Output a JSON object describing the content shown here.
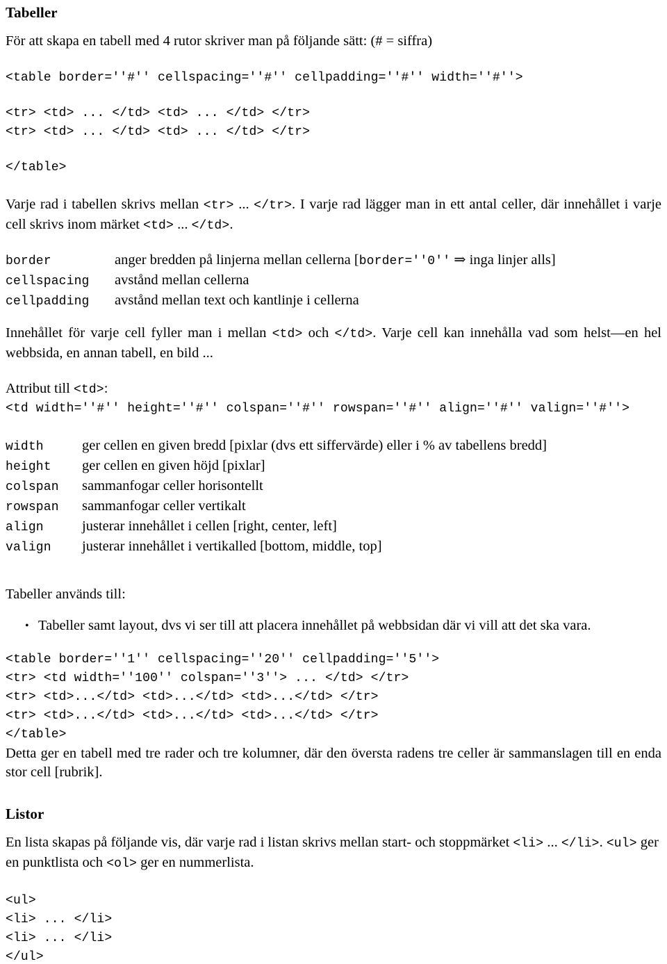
{
  "document": {
    "language": "sv",
    "sections": [
      {
        "id": "tabeller",
        "heading": "Tabeller"
      },
      {
        "id": "listor",
        "heading": "Listor"
      }
    ]
  },
  "tabeller": {
    "heading": "Tabeller",
    "intro": "För att skapa en tabell med 4 rutor skriver man på följande sätt: (# = siffra)",
    "code_block_1": "<table border=''#'' cellspacing=''#'' cellpadding=''#'' width=''#''>",
    "code_block_2_line1": "<tr> <td> ... </td> <td> ... </td> </tr>",
    "code_block_2_line2": "<tr> <td> ... </td> <td> ... </td> </tr>",
    "code_block_3": "</table>",
    "paragraph_rows": {
      "part1": "Varje rad i tabellen skrivs mellan ",
      "code1": "<tr>",
      "part2": " ... ",
      "code2": "</tr>",
      "part3": ". I varje rad lägger man in ett antal celler, där innehållet i varje cell skrivs inom märket ",
      "code3": "<td>",
      "part4": " ... ",
      "code4": "</td>",
      "part5": "."
    },
    "table_attrs": {
      "rows": [
        {
          "key": "border",
          "desc_pre": "anger bredden på linjerna mellan cellerna [",
          "desc_code": "border=''0''",
          "desc_mid": " ⇒ ",
          "desc_post": "inga linjer alls]"
        },
        {
          "key": "cellspacing",
          "desc_pre": "avstånd mellan cellerna",
          "desc_code": "",
          "desc_mid": "",
          "desc_post": ""
        },
        {
          "key": "cellpadding",
          "desc_pre": "avstånd mellan text och kantlinje i cellerna",
          "desc_code": "",
          "desc_mid": "",
          "desc_post": ""
        }
      ]
    },
    "paragraph_cells": {
      "part1": "Innehållet för varje cell fyller man i mellan ",
      "code1": "<td>",
      "part2": " och ",
      "code2": "</td>",
      "part3": ". Varje cell kan innehålla vad som helst—en hel webbsida, en annan tabell, en bild ..."
    },
    "attribut_label_pre": "Attribut till ",
    "attribut_label_code": "<td>",
    "attribut_label_post": ":",
    "td_code_line": "<td width=''#'' height=''#'' colspan=''#'' rowspan=''#'' align=''#'' valign=''#''>",
    "td_attrs": {
      "rows": [
        {
          "key": "width",
          "desc": "ger cellen en given bredd [pixlar (dvs ett siffervärde) eller i % av tabellens bredd]"
        },
        {
          "key": "height",
          "desc": "ger cellen en given höjd [pixlar]"
        },
        {
          "key": "colspan",
          "desc": "sammanfogar celler horisontellt"
        },
        {
          "key": "rowspan",
          "desc": "sammanfogar celler vertikalt"
        },
        {
          "key": "align",
          "desc": "justerar innehållet i cellen [right, center, left]"
        },
        {
          "key": "valign",
          "desc": "justerar innehållet i vertikalled [bottom, middle, top]"
        }
      ]
    },
    "usage_label": "Tabeller används till:",
    "usage_bullets": [
      {
        "bullet": "•",
        "text": "Tabeller samt layout, dvs vi ser till att placera innehållet på webbsidan där vi vill att det ska vara."
      }
    ],
    "example_code": "<table border=''1'' cellspacing=''20'' cellpadding=''5''>\n<tr> <td width=''100'' colspan=''3''> ... </td> </tr>\n<tr> <td>...</td> <td>...</td> <td>...</td> </tr>\n<tr> <td>...</td> <td>...</td> <td>...</td> </tr>\n</table>",
    "example_explanation": "Detta ger en tabell med tre rader och tre kolumner, där den översta radens tre celler är sammanslagen till en enda stor cell [rubrik]."
  },
  "listor": {
    "heading": "Listor",
    "intro": {
      "part1": "En lista skapas på följande vis, där varje rad i listan skrivs mellan start- och stoppmärket ",
      "code1": "<li>",
      "part2": " ... ",
      "code2": "</li>",
      "part3": ".    ",
      "code3": "<ul>",
      "part4": " ger en punktlista och ",
      "code4": "<ol>",
      "part5": " ger en nummerlista."
    },
    "code_block": "<ul>\n<li> ... </li>\n<li> ... </li>\n</ul>"
  }
}
